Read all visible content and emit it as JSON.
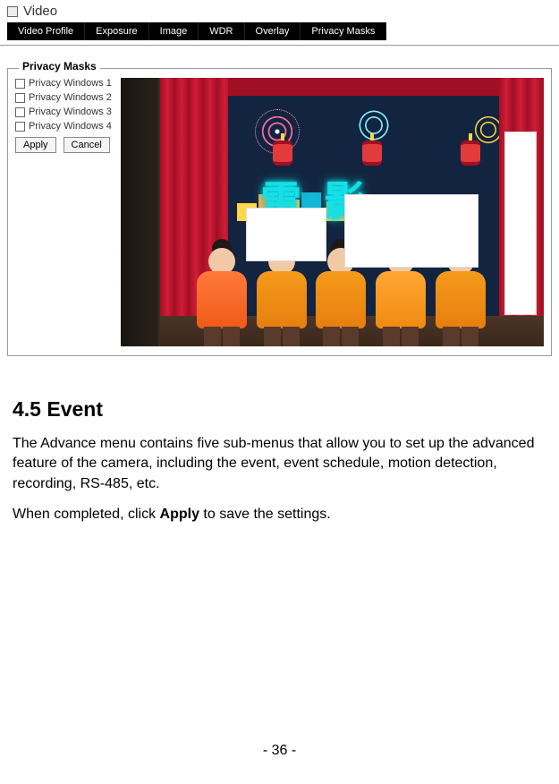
{
  "panel": {
    "title": "Video"
  },
  "tabs": [
    {
      "label": "Video Profile"
    },
    {
      "label": "Exposure"
    },
    {
      "label": "Image"
    },
    {
      "label": "WDR"
    },
    {
      "label": "Overlay"
    },
    {
      "label": "Privacy Masks"
    }
  ],
  "privacy_masks": {
    "legend": "Privacy Masks",
    "options": [
      "Privacy Windows 1",
      "Privacy Windows 2",
      "Privacy Windows 3",
      "Privacy Windows 4"
    ],
    "apply_label": "Apply",
    "cancel_label": "Cancel"
  },
  "doc": {
    "heading": "4.5   Event",
    "para1": "The Advance menu contains five sub-menus that allow you to set up the advanced feature of the camera, including the event, event schedule, motion detection, recording, RS-485, etc.",
    "para2_pre": "When completed, click ",
    "para2_bold": "Apply",
    "para2_post": " to save the settings."
  },
  "page_number": "- 36 -"
}
